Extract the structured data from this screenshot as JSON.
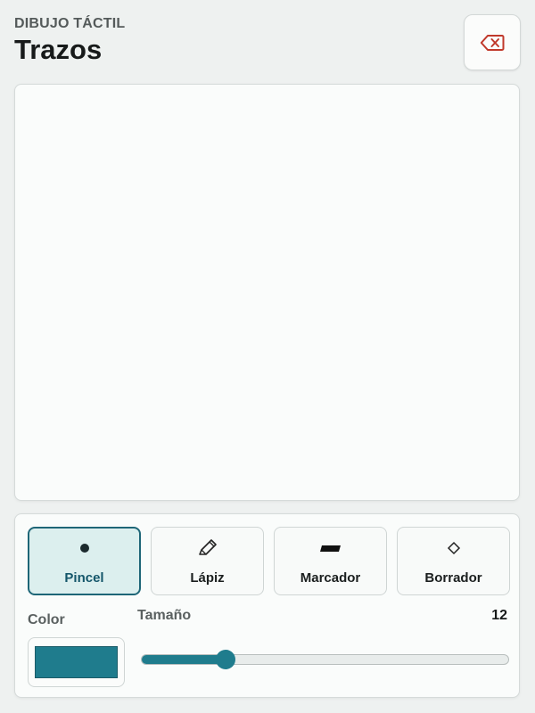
{
  "header": {
    "eyebrow": "DIBUJO TÁCTIL",
    "title": "Trazos"
  },
  "clear_button": {
    "icon": "backspace-icon",
    "color": "#c0392b"
  },
  "canvas": {
    "background": "#fafcfb"
  },
  "tools": [
    {
      "label": "Pincel",
      "icon": "brush-dot-icon",
      "active": true
    },
    {
      "label": "Lápiz",
      "icon": "pencil-icon",
      "active": false
    },
    {
      "label": "Marcador",
      "icon": "marker-icon",
      "active": false
    },
    {
      "label": "Borrador",
      "icon": "eraser-diamond-icon",
      "active": false
    }
  ],
  "color": {
    "label": "Color",
    "value": "#1f7c8d"
  },
  "size": {
    "label": "Tamaño",
    "value": "12",
    "slider_fraction": 0.23
  },
  "accent": "#1f7c8d"
}
